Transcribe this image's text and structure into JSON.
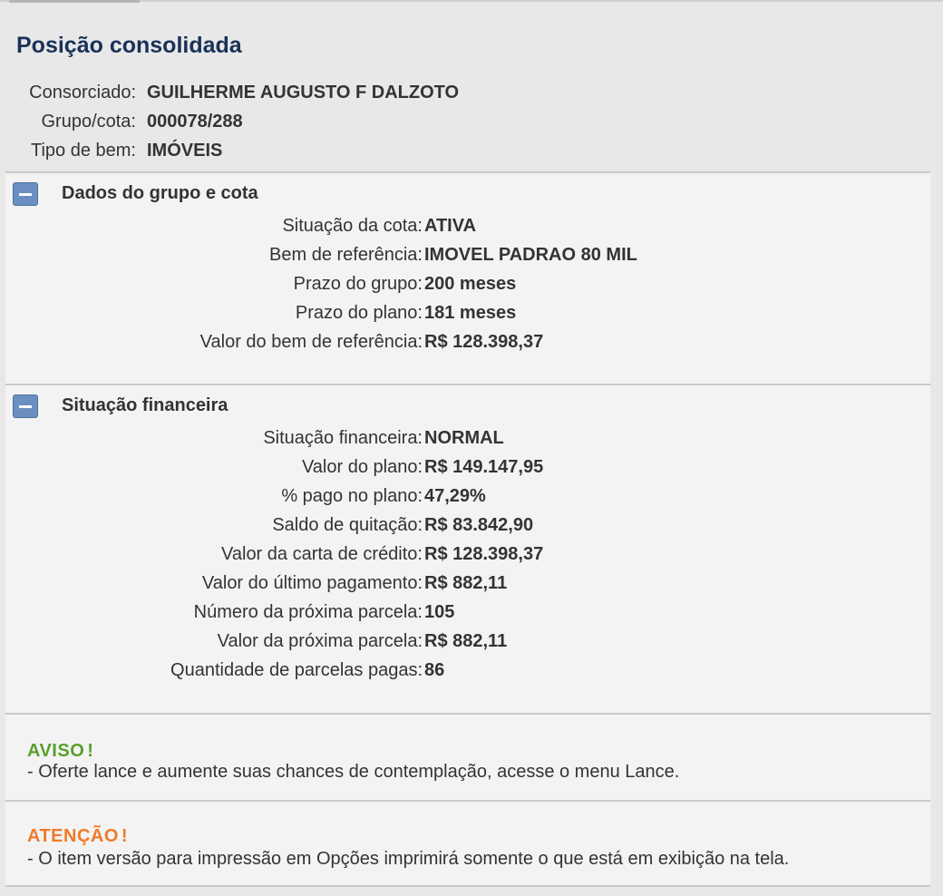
{
  "title": "Posição consolidada",
  "header_info": [
    {
      "label": "Consorciado:",
      "value": "GUILHERME AUGUSTO F DALZOTO"
    },
    {
      "label": "Grupo/cota:",
      "value": "000078/288"
    },
    {
      "label": "Tipo de bem:",
      "value": "IMÓVEIS"
    }
  ],
  "sections": [
    {
      "title": "Dados do grupo e cota",
      "rows": [
        {
          "label": "Situação da cota:",
          "value": "ATIVA"
        },
        {
          "label": "Bem de referência:",
          "value": "IMOVEL PADRAO 80 MIL"
        },
        {
          "label": "Prazo do grupo:",
          "value": "200 meses"
        },
        {
          "label": "Prazo do plano:",
          "value": "181 meses"
        },
        {
          "label": "Valor do bem de referência:",
          "value": "R$ 128.398,37"
        }
      ]
    },
    {
      "title": "Situação financeira",
      "rows": [
        {
          "label": "Situação financeira:",
          "value": "NORMAL"
        },
        {
          "label": "Valor do plano:",
          "value": "R$ 149.147,95"
        },
        {
          "label": "% pago no plano:",
          "value": "47,29%"
        },
        {
          "label": "Saldo de quitação:",
          "value": "R$ 83.842,90"
        },
        {
          "label": "Valor da carta de crédito:",
          "value": "R$ 128.398,37"
        },
        {
          "label": "Valor do último pagamento:",
          "value": "R$ 882,11"
        },
        {
          "label": "Número da próxima parcela:",
          "value": "105"
        },
        {
          "label": "Valor da próxima parcela:",
          "value": "R$ 882,11"
        },
        {
          "label": "Quantidade de parcelas pagas:",
          "value": "86"
        }
      ]
    }
  ],
  "notices": [
    {
      "tag": "AVISO",
      "bang": "!",
      "color": "#5aa02c",
      "text": "- Oferte lance e aumente suas chances de contemplação, acesse o menu Lance."
    },
    {
      "tag": "ATENÇÃO",
      "bang": "!",
      "color": "#f07a2a",
      "text": "- O item versão para impressão em Opções imprimirá somente o que está em exibição na tela."
    }
  ],
  "colors": {
    "title": "#1a3158",
    "collapse_button": "#6b8fc0",
    "panel_bg": "#f3f3f3",
    "page_bg": "#e8e8e8"
  },
  "icons": {
    "collapse": "minus-collapse-icon"
  }
}
